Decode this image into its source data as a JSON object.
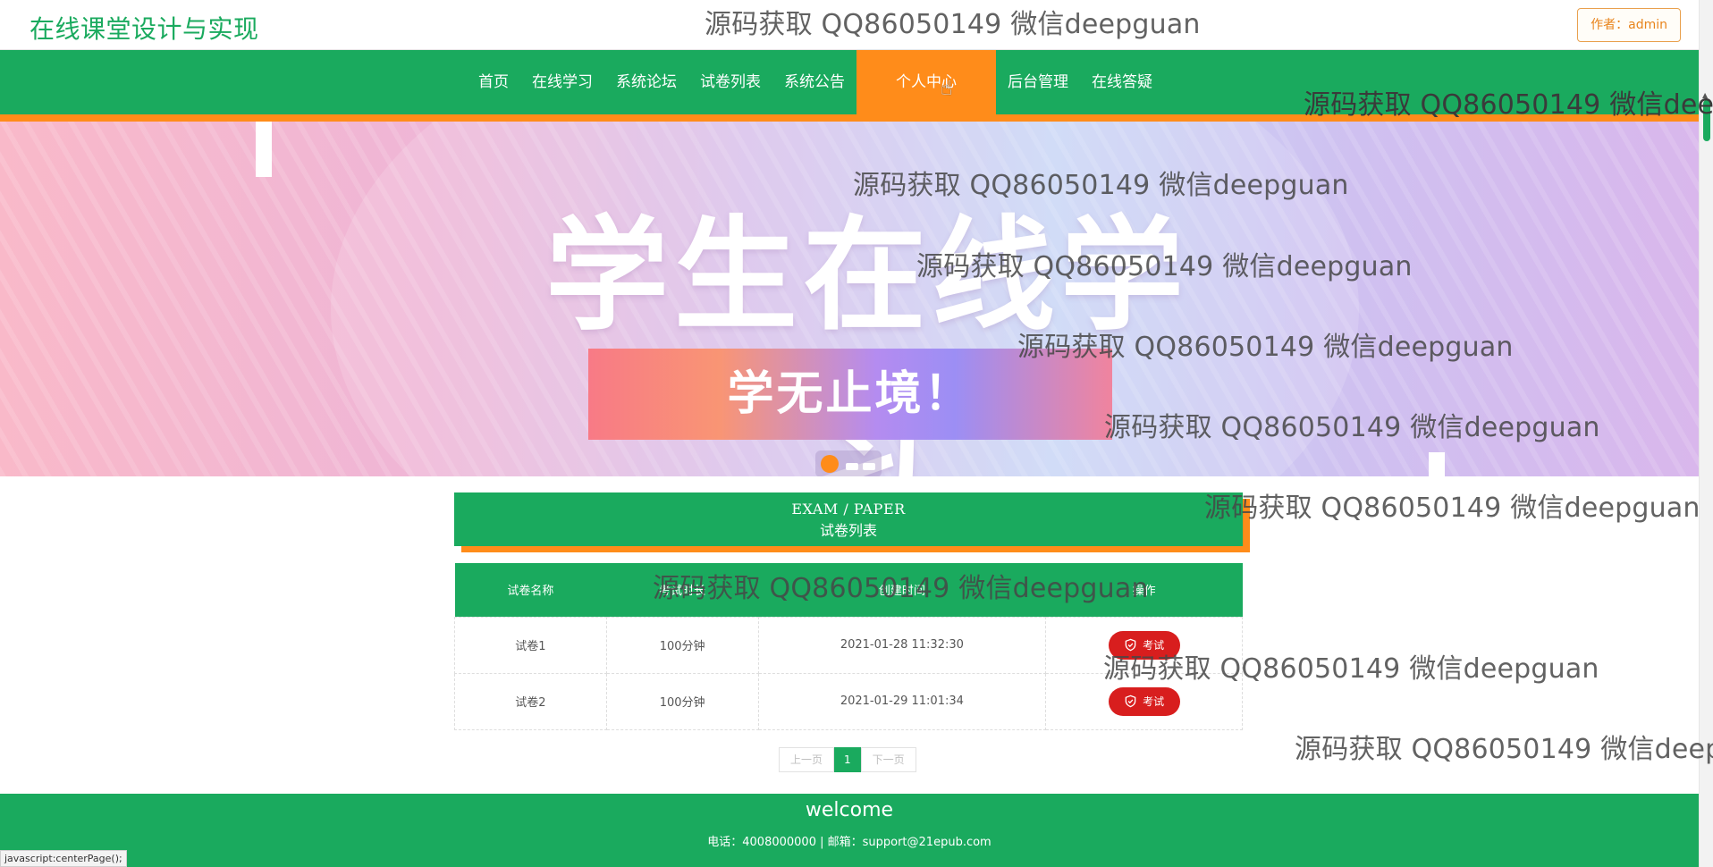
{
  "header": {
    "site_title": "在线课堂设计与实现",
    "author_label": "作者：admin"
  },
  "nav": {
    "items": [
      {
        "label": "首页"
      },
      {
        "label": "在线学习"
      },
      {
        "label": "系统论坛"
      },
      {
        "label": "试卷列表"
      },
      {
        "label": "系统公告"
      },
      {
        "label": "个人中心",
        "active": true
      },
      {
        "label": "后台管理"
      },
      {
        "label": "在线答疑"
      }
    ]
  },
  "banner": {
    "heading": "学生在线学习",
    "ribbon": "学无止境！",
    "slides_total": 3,
    "slide_active": 1
  },
  "section": {
    "en_title": "EXAM / PAPER",
    "cn_title": "试卷列表"
  },
  "table": {
    "headers": [
      "试卷名称",
      "考试时长",
      "创建时间",
      "操作"
    ],
    "rows": [
      {
        "name": "试卷1",
        "duration": "100分钟",
        "created": "2021-01-28 11:32:30",
        "action": "考试"
      },
      {
        "name": "试卷2",
        "duration": "100分钟",
        "created": "2021-01-29 11:01:34",
        "action": "考试"
      }
    ]
  },
  "pagination": {
    "prev": "上一页",
    "current": "1",
    "next": "下一页"
  },
  "footer": {
    "title": "welcome",
    "contact": "电话：4008000000 | 邮箱：support@21epub.com"
  },
  "status_bar": "javascript:centerPage();",
  "watermark": "源码获取 QQ86050149 微信deepguan",
  "colors": {
    "primary_green": "#1aaa5e",
    "accent_orange": "#ff8c1a",
    "exam_button_red": "#d81e1e"
  }
}
